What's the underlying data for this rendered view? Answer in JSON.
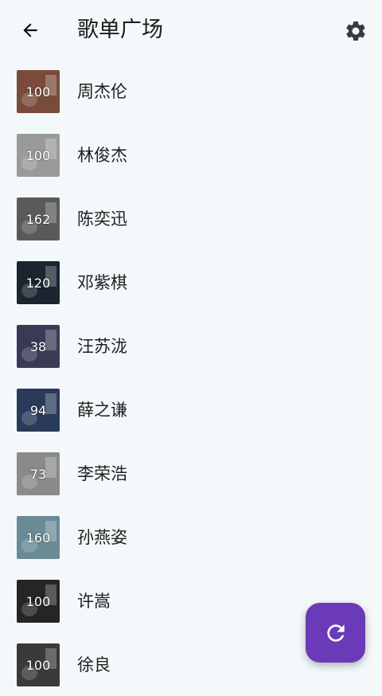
{
  "header": {
    "title": "歌单广场"
  },
  "icons": {
    "back": "arrow-back-icon",
    "settings": "gear-icon",
    "refresh": "refresh-icon"
  },
  "colors": {
    "background": "#f3f9fb",
    "fab": "#6a3ab8",
    "text": "#1f1f1f"
  },
  "playlists": [
    {
      "name": "周杰伦",
      "count": "100",
      "thumb_color": "#7a4a3a"
    },
    {
      "name": "林俊杰",
      "count": "100",
      "thumb_color": "#9a9a9a"
    },
    {
      "name": "陈奕迅",
      "count": "162",
      "thumb_color": "#5a5a5a"
    },
    {
      "name": "邓紫棋",
      "count": "120",
      "thumb_color": "#1a2530"
    },
    {
      "name": "汪苏泷",
      "count": "38",
      "thumb_color": "#3a3a55"
    },
    {
      "name": "薛之谦",
      "count": "94",
      "thumb_color": "#2a3a5a"
    },
    {
      "name": "李荣浩",
      "count": "73",
      "thumb_color": "#8a8a8a"
    },
    {
      "name": "孙燕姿",
      "count": "160",
      "thumb_color": "#6a8a95"
    },
    {
      "name": "许嵩",
      "count": "100",
      "thumb_color": "#252525"
    },
    {
      "name": "徐良",
      "count": "100",
      "thumb_color": "#3a3a3a"
    }
  ]
}
